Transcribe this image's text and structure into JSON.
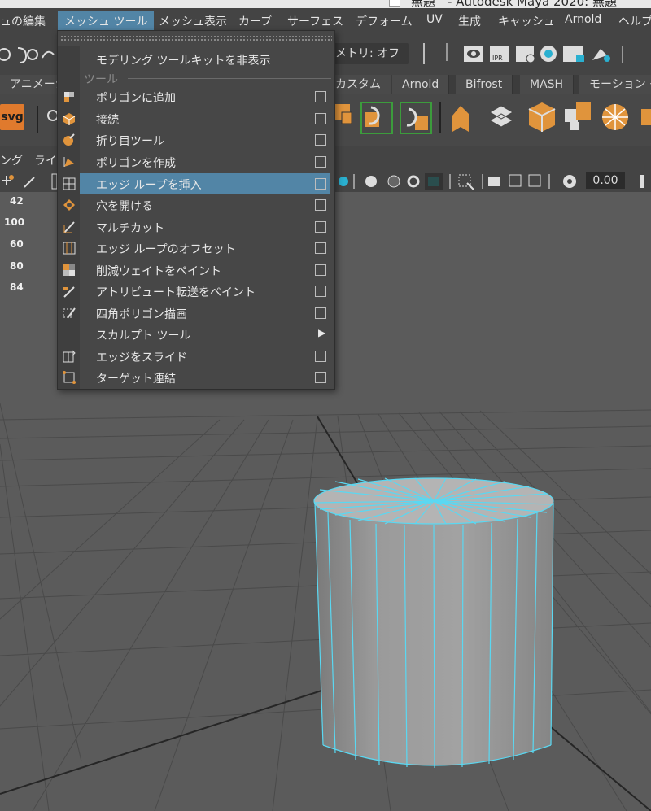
{
  "window": {
    "title": "無題　- Autodesk Maya 2020: 無題"
  },
  "menubar": {
    "items": [
      "ュの編集",
      "メッシュ ツール",
      "メッシュ表示",
      "カーブ",
      "サーフェス",
      "デフォーム",
      "UV",
      "生成",
      "キャッシュ",
      "Arnold",
      "ヘルプ"
    ],
    "active": "メッシュ ツール"
  },
  "statusline": {
    "symmetry": "メトリ: オフ"
  },
  "shelf": {
    "tabs": [
      "アニメーション",
      "カスタム",
      "Arnold",
      "Bifrost",
      "MASH",
      "モーション グ"
    ],
    "svg_label": "svg"
  },
  "panel": {
    "menu": [
      "ング",
      "ライ"
    ],
    "value": "0.00"
  },
  "hud": {
    "values": [
      "42",
      "100",
      "60",
      "80",
      "84"
    ]
  },
  "dropdown": {
    "hide_toolkit": "モデリング ツールキットを非表示",
    "section": "ツール",
    "items": [
      {
        "label": "ポリゴンに追加",
        "icon": "append-polygon-icon"
      },
      {
        "label": "接続",
        "icon": "connect-icon"
      },
      {
        "label": "折り目ツール",
        "icon": "crease-tool-icon"
      },
      {
        "label": "ポリゴンを作成",
        "icon": "create-polygon-icon"
      },
      {
        "label": "エッジ ループを挿入",
        "icon": "insert-edge-loop-icon",
        "highlighted": true
      },
      {
        "label": "穴を開ける",
        "icon": "make-hole-icon"
      },
      {
        "label": "マルチカット",
        "icon": "multi-cut-icon"
      },
      {
        "label": "エッジ ループのオフセット",
        "icon": "offset-edge-loop-icon"
      },
      {
        "label": "削減ウェイトをペイント",
        "icon": "paint-reduce-weights-icon"
      },
      {
        "label": "アトリビュート転送をペイント",
        "icon": "paint-transfer-attributes-icon"
      },
      {
        "label": "四角ポリゴン描画",
        "icon": "quad-draw-icon"
      },
      {
        "label": "スカルプト ツール",
        "icon": "",
        "submenu": true
      },
      {
        "label": "エッジをスライド",
        "icon": "slide-edge-icon"
      },
      {
        "label": "ターゲット連結",
        "icon": "target-weld-icon"
      }
    ]
  },
  "colors": {
    "highlight": "#5285a6",
    "wire": "#4fe0ff",
    "accent": "#e07a2d"
  }
}
